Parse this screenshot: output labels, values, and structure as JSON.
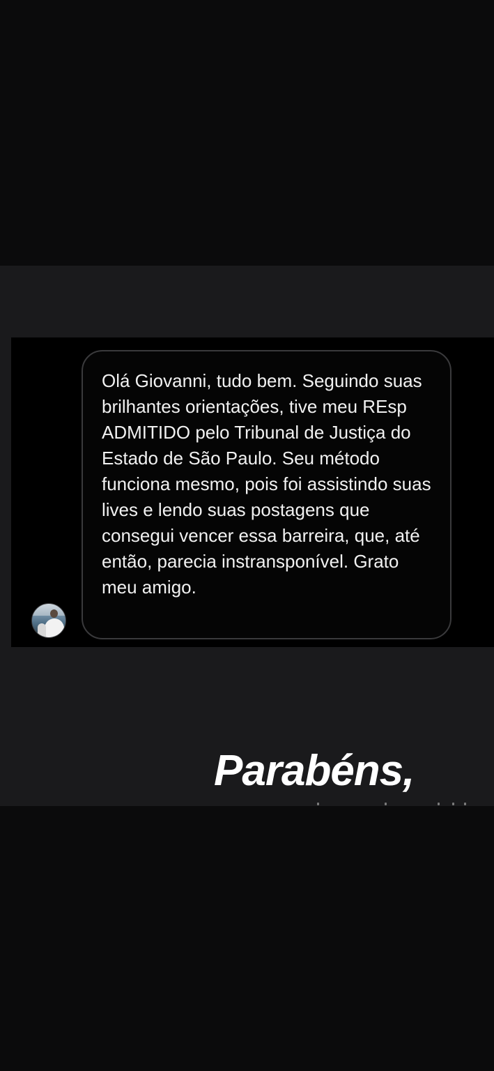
{
  "message": {
    "text": "Olá Giovanni, tudo bem. Seguindo suas brilhantes orientações, tive meu REsp ADMITIDO pelo Tribunal de Justiça do Estado de São Paulo. Seu método funciona mesmo, pois foi assistindo suas lives e lendo suas postagens que consegui vencer essa barreira, que, até então, parecia instransponível. Grato meu amigo."
  },
  "caption": {
    "text": "Parabéns,"
  },
  "icons": {
    "avatar": "profile-avatar"
  },
  "colors": {
    "background": "#0b0b0c",
    "band": "#1a1a1c",
    "card": "#000000",
    "bubble_border": "#3a3a3c",
    "text": "#f1f1f1"
  }
}
